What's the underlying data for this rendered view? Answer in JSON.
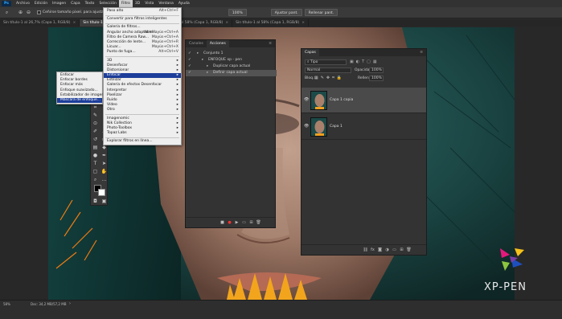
{
  "app": {
    "logo_text": "Ps"
  },
  "menubar": {
    "items": [
      "Archivo",
      "Edición",
      "Imagen",
      "Capa",
      "Texto",
      "Selección",
      "Filtro",
      "3D",
      "Vista",
      "Ventana",
      "Ayuda"
    ],
    "active_index": 6
  },
  "options": {
    "sample_label": "Ceñirse tamaño pixel. para ajustar",
    "buttons": [
      "100%",
      "Ajustar pant.",
      "Rellenar pant."
    ]
  },
  "tabs": [
    {
      "label": "Sin título-1 al 26,7% (Capa 1, RGB/8)",
      "active": false
    },
    {
      "label": "Sin título-1 al 58% (Capa 1, RGB/8)",
      "active": true
    },
    {
      "label": "Sin título-1 al 58% (Capa 1, RGB/8)",
      "active": false
    },
    {
      "label": "Sin título-1 al 58% (Capa 1, RGB/8)",
      "active": false
    }
  ],
  "filter_menu": {
    "items": [
      {
        "label": "Paso alto",
        "shortcut": "Alt+Ctrl+F"
      },
      {
        "sep": true
      },
      {
        "label": "Convertir para filtros inteligentes"
      },
      {
        "sep": true
      },
      {
        "label": "Galería de filtros..."
      },
      {
        "label": "Angular ancho adaptable...",
        "shortcut": "Alt+Mayús+Ctrl+A"
      },
      {
        "label": "Filtro de Camera Raw...",
        "shortcut": "Mayús+Ctrl+A"
      },
      {
        "label": "Corrección de lente...",
        "shortcut": "Mayús+Ctrl+R"
      },
      {
        "label": "Licuar...",
        "shortcut": "Mayús+Ctrl+X"
      },
      {
        "label": "Punto de fuga...",
        "shortcut": "Alt+Ctrl+V"
      },
      {
        "sep": true
      },
      {
        "label": "3D",
        "sub": true
      },
      {
        "label": "Desenfocar",
        "sub": true
      },
      {
        "label": "Distorsionar",
        "sub": true
      },
      {
        "label": "Enfocar",
        "sub": true,
        "selected": true
      },
      {
        "label": "Estilizar",
        "sub": true
      },
      {
        "label": "Galería de efectos Desenfocar",
        "sub": true
      },
      {
        "label": "Interpretar",
        "sub": true
      },
      {
        "label": "Pixelizar",
        "sub": true
      },
      {
        "label": "Ruido",
        "sub": true
      },
      {
        "label": "Vídeo",
        "sub": true
      },
      {
        "label": "Otro",
        "sub": true
      },
      {
        "sep": true
      },
      {
        "label": "Imagenomic",
        "sub": true
      },
      {
        "label": "Nik Collection",
        "sub": true
      },
      {
        "label": "Photo-Toolbox",
        "sub": true
      },
      {
        "label": "Topaz Labs",
        "sub": true
      },
      {
        "sep": true
      },
      {
        "label": "Explorar filtros en línea..."
      }
    ]
  },
  "sharpen_menu": {
    "items": [
      {
        "label": "Enfocar"
      },
      {
        "label": "Enfocar bordes"
      },
      {
        "label": "Enfocar más"
      },
      {
        "label": "Enfoque suavizado..."
      },
      {
        "label": "Estabilizador de imagen..."
      },
      {
        "label": "Máscara de enfoque...",
        "selected": true
      }
    ]
  },
  "actions_panel": {
    "tabs": [
      "Canales",
      "Acciones"
    ],
    "active_tab": 1,
    "rows": [
      {
        "label": "Conjunto 1",
        "indent": 0,
        "checked": true,
        "highlight": false
      },
      {
        "label": "ENFOQUE xp - pen",
        "indent": 1,
        "checked": true,
        "highlight": false
      },
      {
        "label": "Duplicar capa actual",
        "indent": 2,
        "checked": true,
        "highlight": false
      },
      {
        "label": "Definir capa actual",
        "indent": 2,
        "checked": true,
        "highlight": true
      }
    ]
  },
  "layers_panel": {
    "title": "Capas",
    "filter_label": "Tipo",
    "blend_mode": "Normal",
    "opacity_label": "Opacidad:",
    "opacity_value": "100%",
    "lock_label": "Bloq.:",
    "fill_label": "Relleno:",
    "fill_value": "100%",
    "layers": [
      {
        "name": "Capa 1 copia",
        "selected": true
      },
      {
        "name": "Capa 1",
        "selected": false
      }
    ]
  },
  "status": {
    "zoom": "58%",
    "doc": "Doc: 34,2 MB/57,2 MB"
  },
  "brand": {
    "text": "XP-PEN"
  },
  "colors": {
    "accent": "#1c3d99",
    "ps_blue": "#31a8ff"
  }
}
